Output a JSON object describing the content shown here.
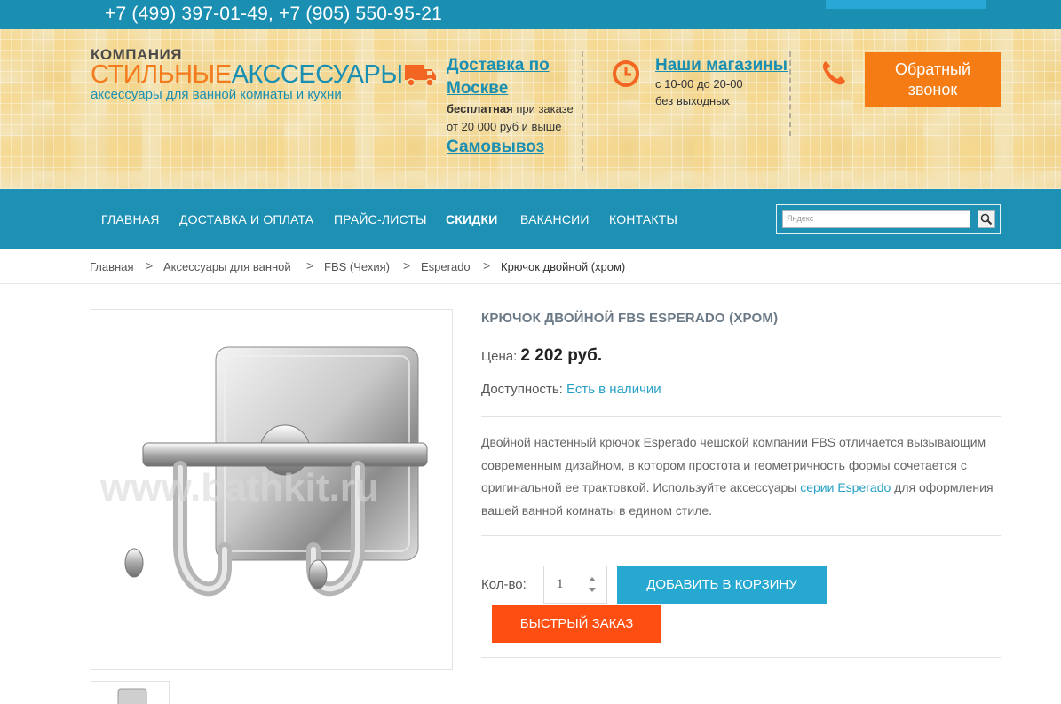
{
  "topbar": {
    "phones": "+7 (499) 397-01-49, +7 (905) 550-95-21"
  },
  "logo": {
    "line1": "КОМПАНИЯ",
    "brand_part1": "СТИЛЬНЫЕ",
    "brand_part2": "АКССЕСУАРЫ",
    "tagline": "аксессуары для ванной комнаты и кухни"
  },
  "delivery": {
    "link": "Доставка по Москве",
    "note_bold": "бесплатная",
    "note_rest": " при заказе от 20 000 руб и выше",
    "pickup": "Самовывоз"
  },
  "stores": {
    "link": "Наши магазины",
    "hours": "с 10-00 до 20-00",
    "days": "без выходных"
  },
  "callback": {
    "line1": "Обратный",
    "line2": "звонок"
  },
  "nav": {
    "items": [
      {
        "label": "Главная"
      },
      {
        "label": "Доставка и оплата"
      },
      {
        "label": "Прайс-листы"
      },
      {
        "label": "Скидки"
      },
      {
        "label": "Вакансии"
      },
      {
        "label": "Контакты"
      }
    ],
    "search_placeholder": "Яндекс"
  },
  "breadcrumbs": {
    "items": [
      "Главная",
      "Аксессуары для ванной",
      "FBS (Чехия)",
      "Esperado"
    ],
    "current": "Крючок двойной (хром)",
    "separator": ">"
  },
  "product": {
    "title": "Крючок двойной FBS Esperado (хром)",
    "price_label": "Цена:",
    "price_value": "2 202 руб.",
    "avail_label": "Доступность:",
    "avail_value": "Есть в наличии",
    "desc_before": "Двойной настенный крючок Esperado чешской компании FBS отличается вызывающим современным дизайном, в котором простота и геометричность формы сочетается с оригинальной ее трактовкой. Используйте аксессуары ",
    "desc_link": "серии Esperado",
    "desc_after": " для оформления вашей ванной комнаты в едином стиле.",
    "watermark": "www.bathkit.ru",
    "qty_label": "Кол-во:",
    "qty_value": "1",
    "add_to_cart": "Добавить в корзину",
    "quick_order": "Быстрый заказ"
  },
  "colors": {
    "brand_blue": "#1b8fb2",
    "brand_orange": "#f47a1e",
    "callback_orange": "#f57c14",
    "cart_blue": "#27a8d1",
    "quick_red": "#ff4e12"
  },
  "icons": [
    "truck-icon",
    "clock-icon",
    "phone-icon",
    "search-icon",
    "spinner-up-icon",
    "spinner-down-icon"
  ]
}
